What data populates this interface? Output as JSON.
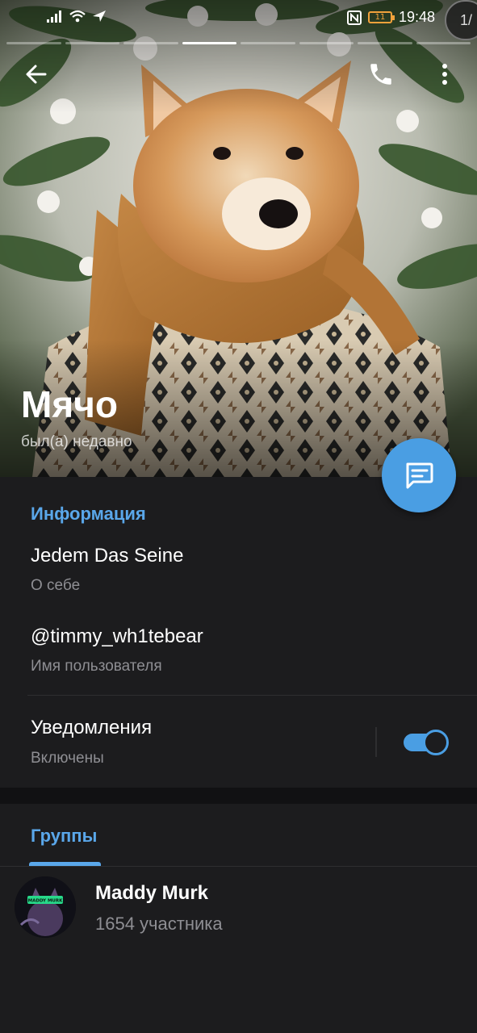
{
  "status_bar": {
    "time": "19:48",
    "battery_level": "11",
    "page_indicator": "1/",
    "icons": [
      "signal-icon",
      "wifi-icon",
      "location-arrow-icon",
      "nfc-icon",
      "battery-icon"
    ]
  },
  "photo": {
    "segments_total": 8,
    "segment_active": 4
  },
  "toolbar": {
    "back_icon": "arrow-left-icon",
    "call_icon": "phone-icon",
    "more_icon": "more-vertical-icon"
  },
  "profile": {
    "name": "Мячо",
    "status": "был(а) недавно"
  },
  "fab": {
    "icon": "message-icon"
  },
  "info": {
    "title": "Информация",
    "bio": "Jedem Das Seine",
    "bio_label": "О себе",
    "username": "@timmy_wh1tebear",
    "username_label": "Имя пользователя",
    "notifications": "Уведомления",
    "notifications_status": "Включены",
    "notifications_on": true
  },
  "groups": {
    "tab_label": "Группы",
    "items": [
      {
        "name": "Maddy Murk",
        "members": "1654 участника",
        "avatar_text": "MADDY MURK"
      }
    ]
  },
  "colors": {
    "accent": "#5aa7ea",
    "fab": "#4a9ee3",
    "background": "#1c1c1e",
    "secondary_text": "#8e8e93"
  }
}
